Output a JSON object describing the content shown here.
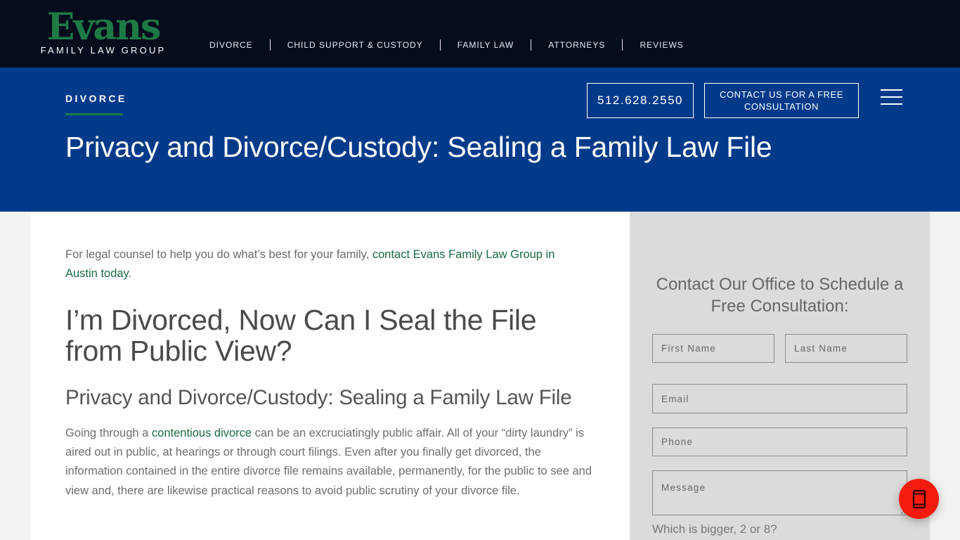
{
  "header": {
    "logo": {
      "word": "Evans",
      "subtitle": "FAMILY LAW GROUP"
    },
    "nav": [
      {
        "label": "DIVORCE"
      },
      {
        "label": "CHILD SUPPORT & CUSTODY"
      },
      {
        "label": "FAMILY LAW"
      },
      {
        "label": "ATTORNEYS"
      },
      {
        "label": "REVIEWS"
      }
    ]
  },
  "hero": {
    "breadcrumb": "DIVORCE",
    "phone": "512.628.2550",
    "consult_button": "CONTACT US FOR A FREE CONSULTATION",
    "menu_icon": "hamburger-icon",
    "title": "Privacy and Divorce/Custody: Sealing a Family Law File"
  },
  "content": {
    "intro_text": "For legal counsel to help you do what’s best for your family, ",
    "intro_link": "contact Evans Family Law Group in Austin today",
    "intro_end": ".",
    "heading": "I’m Divorced, Now Can I Seal the File from Public View?",
    "subheading": "Privacy and Divorce/Custody: Sealing a Family Law File",
    "para_start": "Going through a ",
    "para_link": "contentious divorce",
    "para_rest": " can be an excruciatingly public affair. All of your “dirty laundry” is aired out in public, at hearings or through court filings. Even after you finally get divorced, the information contained in the entire divorce file remains available, permanently, for the public to see and view and, there are likewise practical reasons to avoid public scrutiny of your divorce file."
  },
  "form": {
    "title": "Contact Our Office to Schedule a Free Consultation:",
    "first_name_placeholder": "First Name",
    "last_name_placeholder": "Last Name",
    "email_placeholder": "Email",
    "phone_placeholder": "Phone",
    "message_placeholder": "Message",
    "captcha_question": "Which is bigger, 2 or 8?"
  },
  "fab": {
    "icon": "mobile-phone-icon"
  },
  "colors": {
    "topbar": "#050c1c",
    "hero": "#023a8a",
    "brand_green": "#1d7a45",
    "link_green": "#1a6b43",
    "fab_red": "#f41c0e",
    "sidebar_bg": "#dcdbd9"
  }
}
